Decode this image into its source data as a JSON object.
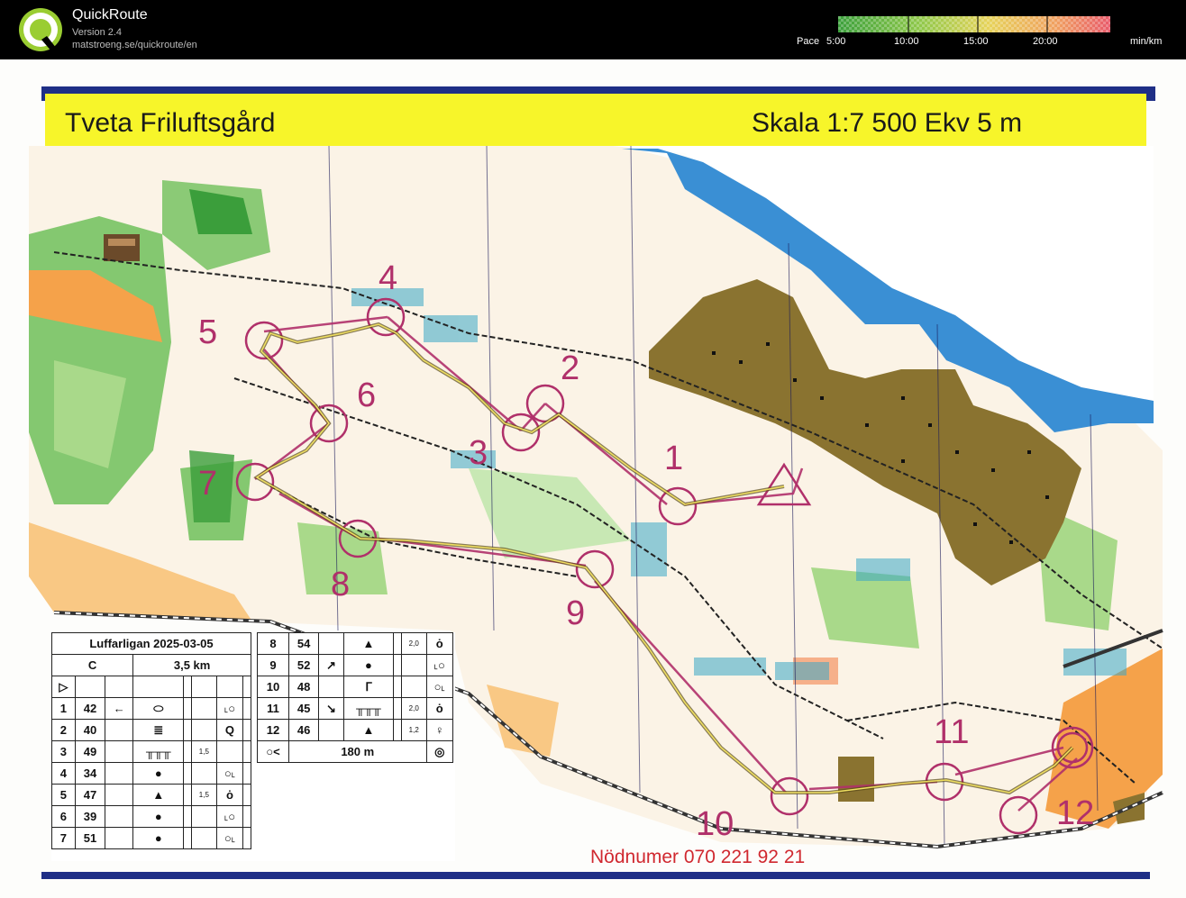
{
  "app": {
    "name": "QuickRoute",
    "version": "Version 2.4",
    "url": "matstroeng.se/quickroute/en"
  },
  "pace_scale": {
    "prefix": "Pace",
    "ticks": [
      "5:00",
      "10:00",
      "15:00",
      "20:00"
    ],
    "unit": "min/km",
    "colors": [
      "#3ca03c",
      "#8fc84a",
      "#e6d35a",
      "#f0a060",
      "#e85a6a"
    ]
  },
  "map": {
    "title": "Tveta Friluftsgård",
    "scale": "Skala 1:7 500 Ekv 5 m",
    "emergency": "Nödnumer 070 221 92 21",
    "colors": {
      "header_yellow": "#f7f52a",
      "frame_blue": "#1f2f86",
      "water": "#3a8fd4",
      "forest_green": "#6fbf5a",
      "open_orange": "#f5a24a",
      "settlement_brown": "#8a7330",
      "course_magenta": "#b0306a"
    },
    "controls": [
      {
        "label": "1"
      },
      {
        "label": "2"
      },
      {
        "label": "3"
      },
      {
        "label": "4"
      },
      {
        "label": "5"
      },
      {
        "label": "6"
      },
      {
        "label": "7"
      },
      {
        "label": "8"
      },
      {
        "label": "9"
      },
      {
        "label": "10"
      },
      {
        "label": "11"
      },
      {
        "label": "12"
      }
    ]
  },
  "description": {
    "event": "Luffarligan 2025-03-05",
    "class": "C",
    "length": "3,5 km",
    "start_symbol": "▷",
    "rows_left": [
      {
        "n": "1",
        "code": "42",
        "sym1": "←",
        "sym2": "⬭",
        "size": "",
        "extra": "˪○"
      },
      {
        "n": "2",
        "code": "40",
        "sym1": "",
        "sym2": "≣",
        "size": "",
        "extra": "Q"
      },
      {
        "n": "3",
        "code": "49",
        "sym1": "",
        "sym2": "╥╥╥",
        "size": "1,5",
        "extra": ""
      },
      {
        "n": "4",
        "code": "34",
        "sym1": "",
        "sym2": "●",
        "size": "",
        "extra": "○˪"
      },
      {
        "n": "5",
        "code": "47",
        "sym1": "",
        "sym2": "▲",
        "size": "1,5",
        "extra": "ȯ"
      },
      {
        "n": "6",
        "code": "39",
        "sym1": "",
        "sym2": "●",
        "size": "",
        "extra": "˪○"
      },
      {
        "n": "7",
        "code": "51",
        "sym1": "",
        "sym2": "●",
        "size": "",
        "extra": "○˪"
      }
    ],
    "rows_right": [
      {
        "n": "8",
        "code": "54",
        "sym1": "",
        "sym2": "▲",
        "size": "2,0",
        "extra": "ȯ"
      },
      {
        "n": "9",
        "code": "52",
        "sym1": "↗",
        "sym2": "●",
        "size": "",
        "extra": "˪○"
      },
      {
        "n": "10",
        "code": "48",
        "sym1": "",
        "sym2": "ᒥ",
        "size": "",
        "extra": "○˪"
      },
      {
        "n": "11",
        "code": "45",
        "sym1": "↘",
        "sym2": "╥╥╥",
        "size": "2,0",
        "extra": "ȯ"
      },
      {
        "n": "12",
        "code": "46",
        "sym1": "",
        "sym2": "▲",
        "size": "1,2",
        "extra": "♀"
      }
    ],
    "finish": {
      "start_sym": "○<",
      "distance": "180 m",
      "end_sym": "◎"
    }
  }
}
